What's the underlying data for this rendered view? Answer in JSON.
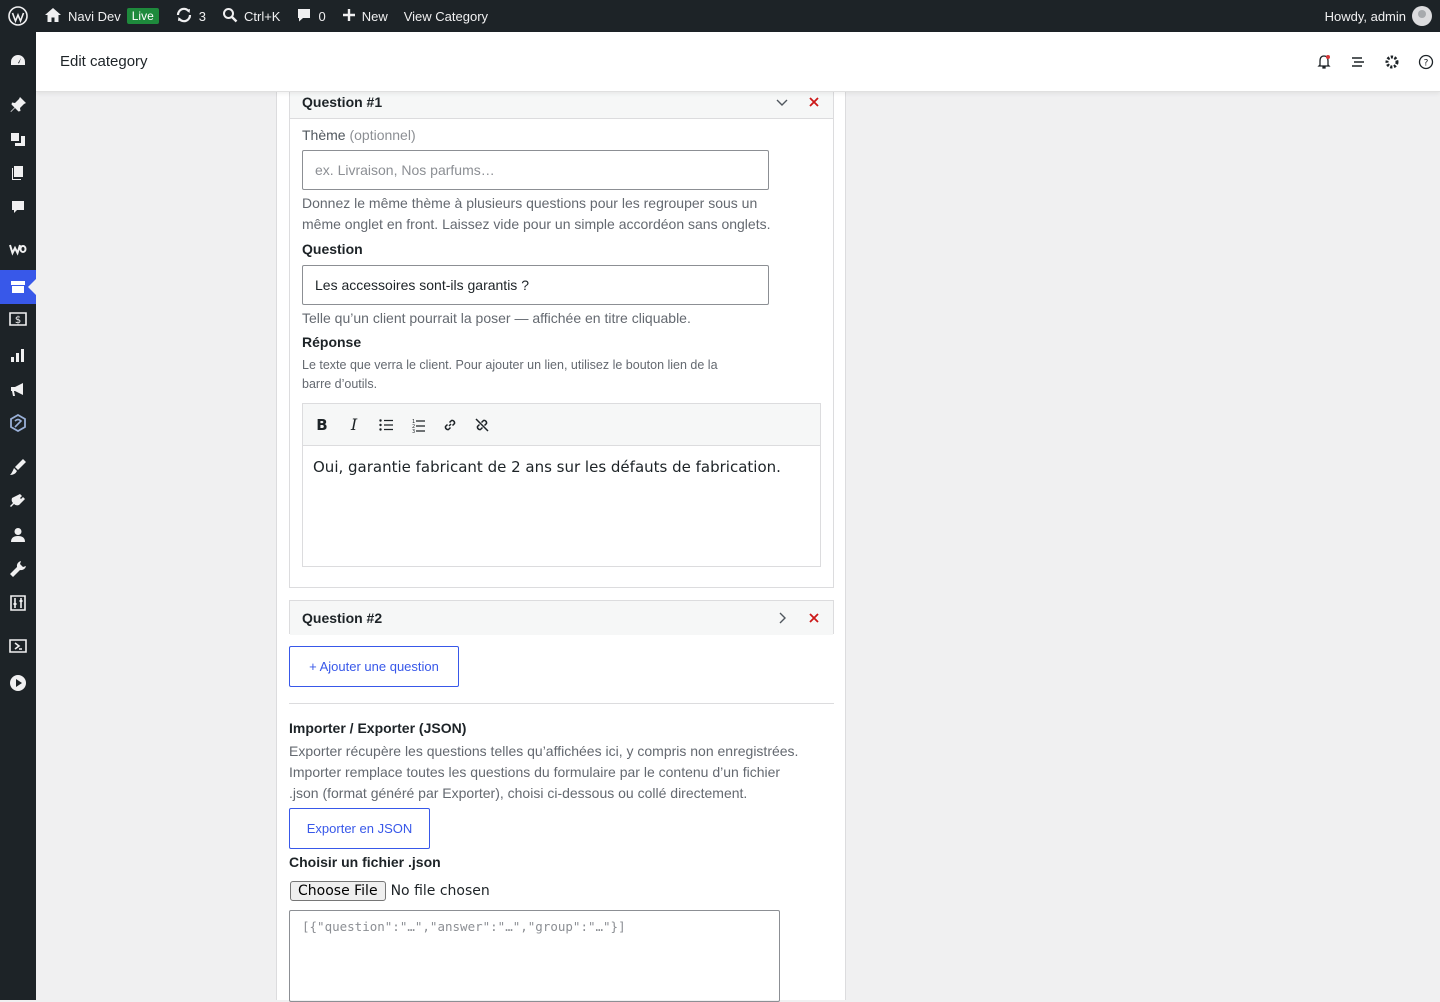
{
  "adminbar": {
    "site_name": "Navi Dev",
    "live_badge": "Live",
    "updates_count": "3",
    "search_shortcut": "Ctrl+K",
    "comments_count": "0",
    "new_label": "New",
    "view_label": "View Category",
    "greeting": "Howdy, admin"
  },
  "header": {
    "title": "Edit category"
  },
  "question1": {
    "title": "Question #1",
    "theme_label": "Thème",
    "theme_optional": "(optionnel)",
    "theme_placeholder": "ex. Livraison, Nos parfums…",
    "theme_help_1": "Donnez le même thème à plusieurs questions pour les regrouper sous un",
    "theme_help_2": "même onglet en front. Laissez vide pour un simple accordéon sans onglets.",
    "question_label": "Question",
    "question_value": "Les accessoires sont-ils garantis ?",
    "question_help": "Telle qu’un client pourrait la poser — affichée en titre cliquable.",
    "answer_label": "Réponse",
    "answer_help_1": "Le texte que verra le client. Pour ajouter un lien, utilisez le bouton lien de la",
    "answer_help_2": "barre d’outils.",
    "answer_value": "Oui, garantie fabricant de 2 ans sur les défauts de fabrication."
  },
  "question2": {
    "title": "Question #2"
  },
  "add_question_label": "+ Ajouter une question",
  "import_export": {
    "heading": "Importer / Exporter (JSON)",
    "desc_1": "Exporter récupère les questions telles qu’affichées ici, y compris non enregistrées.",
    "desc_2": "Importer remplace toutes les questions du formulaire par le contenu d’un fichier",
    "desc_3": ".json (format généré par Exporter), choisi ci-dessous ou collé directement.",
    "export_label": "Exporter en JSON",
    "file_label": "Choisir un fichier .json",
    "choose_file": "Choose File",
    "no_file": "No file chosen",
    "textarea_placeholder": "[{\"question\":\"…\",\"answer\":\"…\",\"group\":\"…\"}]"
  },
  "colors": {
    "accent": "#3858e9",
    "danger": "#cc1818",
    "adminbar": "#1d2327"
  }
}
